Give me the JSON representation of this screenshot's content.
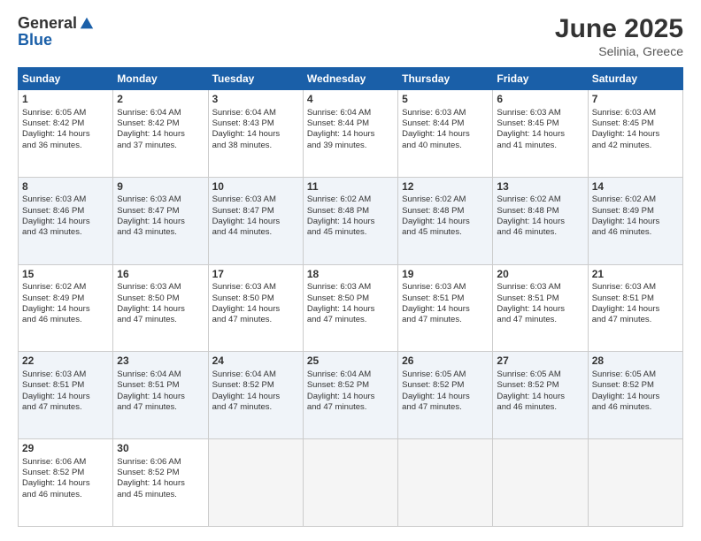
{
  "logo": {
    "general": "General",
    "blue": "Blue"
  },
  "title": "June 2025",
  "location": "Selinia, Greece",
  "headers": [
    "Sunday",
    "Monday",
    "Tuesday",
    "Wednesday",
    "Thursday",
    "Friday",
    "Saturday"
  ],
  "weeks": [
    [
      {
        "day": "1",
        "info": "Sunrise: 6:05 AM\nSunset: 8:42 PM\nDaylight: 14 hours\nand 36 minutes."
      },
      {
        "day": "2",
        "info": "Sunrise: 6:04 AM\nSunset: 8:42 PM\nDaylight: 14 hours\nand 37 minutes."
      },
      {
        "day": "3",
        "info": "Sunrise: 6:04 AM\nSunset: 8:43 PM\nDaylight: 14 hours\nand 38 minutes."
      },
      {
        "day": "4",
        "info": "Sunrise: 6:04 AM\nSunset: 8:44 PM\nDaylight: 14 hours\nand 39 minutes."
      },
      {
        "day": "5",
        "info": "Sunrise: 6:03 AM\nSunset: 8:44 PM\nDaylight: 14 hours\nand 40 minutes."
      },
      {
        "day": "6",
        "info": "Sunrise: 6:03 AM\nSunset: 8:45 PM\nDaylight: 14 hours\nand 41 minutes."
      },
      {
        "day": "7",
        "info": "Sunrise: 6:03 AM\nSunset: 8:45 PM\nDaylight: 14 hours\nand 42 minutes."
      }
    ],
    [
      {
        "day": "8",
        "info": "Sunrise: 6:03 AM\nSunset: 8:46 PM\nDaylight: 14 hours\nand 43 minutes."
      },
      {
        "day": "9",
        "info": "Sunrise: 6:03 AM\nSunset: 8:47 PM\nDaylight: 14 hours\nand 43 minutes."
      },
      {
        "day": "10",
        "info": "Sunrise: 6:03 AM\nSunset: 8:47 PM\nDaylight: 14 hours\nand 44 minutes."
      },
      {
        "day": "11",
        "info": "Sunrise: 6:02 AM\nSunset: 8:48 PM\nDaylight: 14 hours\nand 45 minutes."
      },
      {
        "day": "12",
        "info": "Sunrise: 6:02 AM\nSunset: 8:48 PM\nDaylight: 14 hours\nand 45 minutes."
      },
      {
        "day": "13",
        "info": "Sunrise: 6:02 AM\nSunset: 8:48 PM\nDaylight: 14 hours\nand 46 minutes."
      },
      {
        "day": "14",
        "info": "Sunrise: 6:02 AM\nSunset: 8:49 PM\nDaylight: 14 hours\nand 46 minutes."
      }
    ],
    [
      {
        "day": "15",
        "info": "Sunrise: 6:02 AM\nSunset: 8:49 PM\nDaylight: 14 hours\nand 46 minutes."
      },
      {
        "day": "16",
        "info": "Sunrise: 6:03 AM\nSunset: 8:50 PM\nDaylight: 14 hours\nand 47 minutes."
      },
      {
        "day": "17",
        "info": "Sunrise: 6:03 AM\nSunset: 8:50 PM\nDaylight: 14 hours\nand 47 minutes."
      },
      {
        "day": "18",
        "info": "Sunrise: 6:03 AM\nSunset: 8:50 PM\nDaylight: 14 hours\nand 47 minutes."
      },
      {
        "day": "19",
        "info": "Sunrise: 6:03 AM\nSunset: 8:51 PM\nDaylight: 14 hours\nand 47 minutes."
      },
      {
        "day": "20",
        "info": "Sunrise: 6:03 AM\nSunset: 8:51 PM\nDaylight: 14 hours\nand 47 minutes."
      },
      {
        "day": "21",
        "info": "Sunrise: 6:03 AM\nSunset: 8:51 PM\nDaylight: 14 hours\nand 47 minutes."
      }
    ],
    [
      {
        "day": "22",
        "info": "Sunrise: 6:03 AM\nSunset: 8:51 PM\nDaylight: 14 hours\nand 47 minutes."
      },
      {
        "day": "23",
        "info": "Sunrise: 6:04 AM\nSunset: 8:51 PM\nDaylight: 14 hours\nand 47 minutes."
      },
      {
        "day": "24",
        "info": "Sunrise: 6:04 AM\nSunset: 8:52 PM\nDaylight: 14 hours\nand 47 minutes."
      },
      {
        "day": "25",
        "info": "Sunrise: 6:04 AM\nSunset: 8:52 PM\nDaylight: 14 hours\nand 47 minutes."
      },
      {
        "day": "26",
        "info": "Sunrise: 6:05 AM\nSunset: 8:52 PM\nDaylight: 14 hours\nand 47 minutes."
      },
      {
        "day": "27",
        "info": "Sunrise: 6:05 AM\nSunset: 8:52 PM\nDaylight: 14 hours\nand 46 minutes."
      },
      {
        "day": "28",
        "info": "Sunrise: 6:05 AM\nSunset: 8:52 PM\nDaylight: 14 hours\nand 46 minutes."
      }
    ],
    [
      {
        "day": "29",
        "info": "Sunrise: 6:06 AM\nSunset: 8:52 PM\nDaylight: 14 hours\nand 46 minutes."
      },
      {
        "day": "30",
        "info": "Sunrise: 6:06 AM\nSunset: 8:52 PM\nDaylight: 14 hours\nand 45 minutes."
      },
      null,
      null,
      null,
      null,
      null
    ]
  ]
}
